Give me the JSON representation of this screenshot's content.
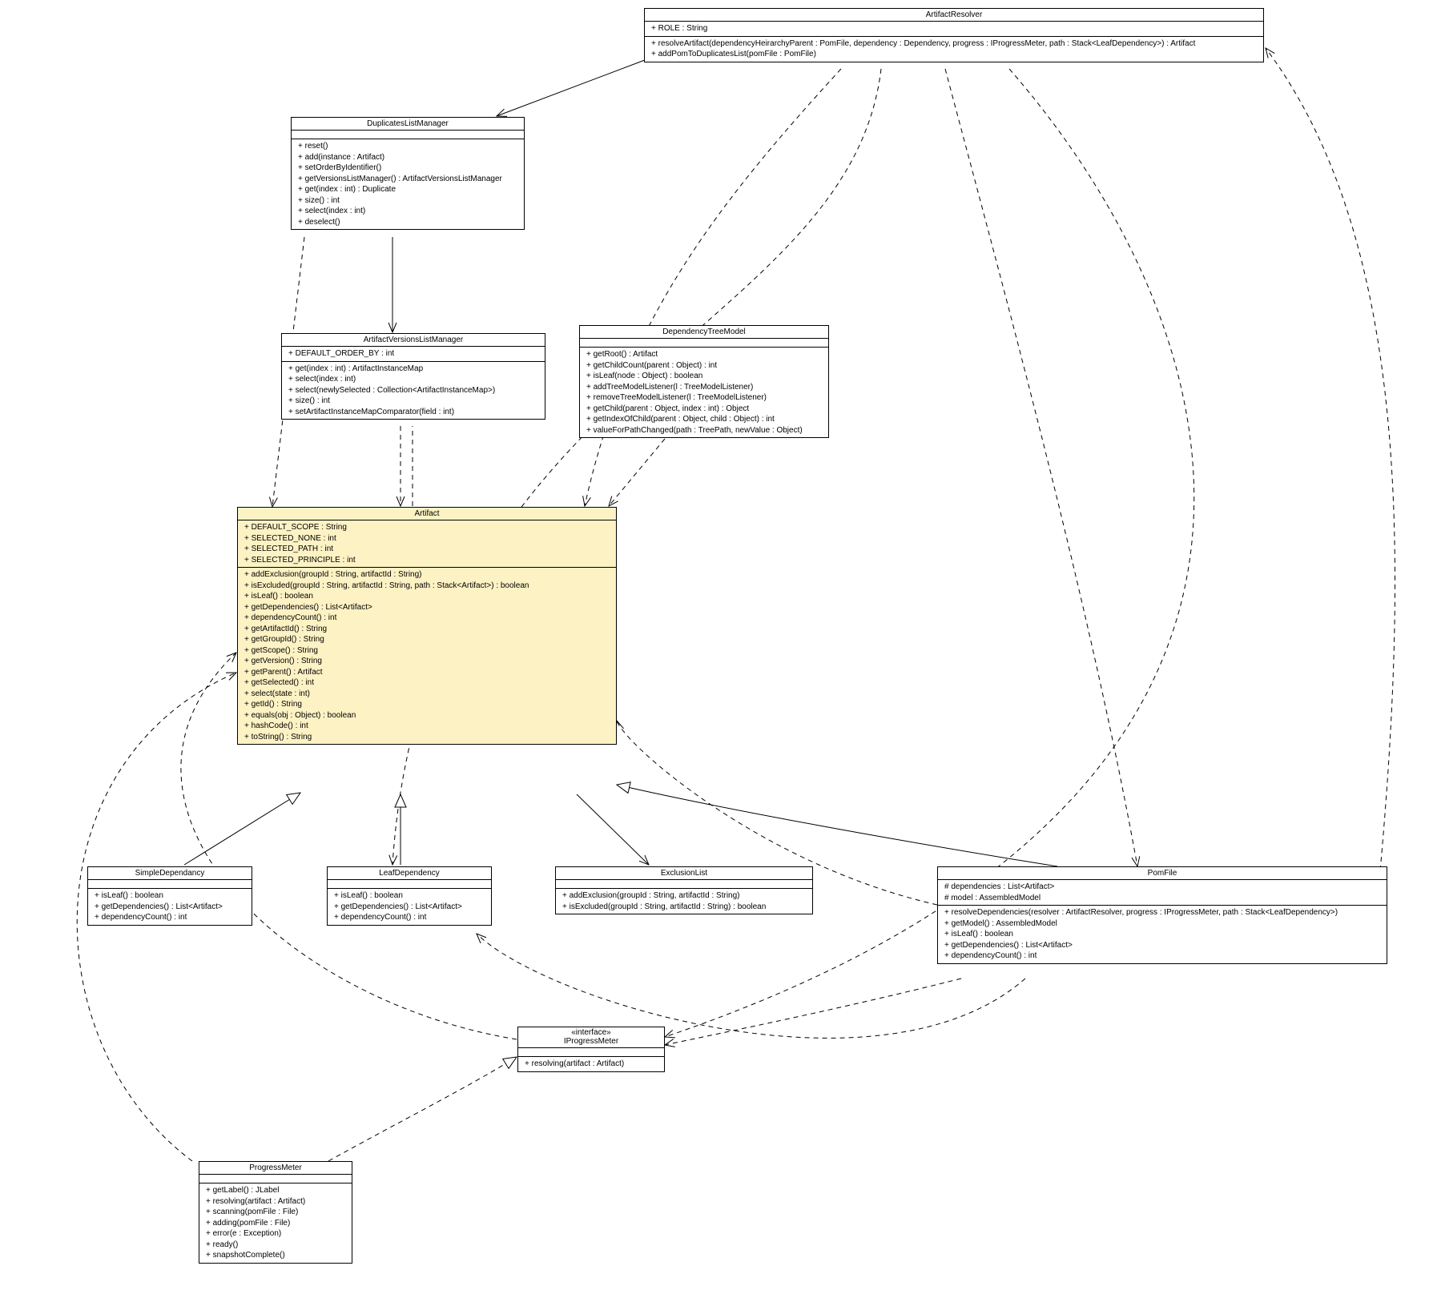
{
  "classes": {
    "artifactResolver": {
      "title": "ArtifactResolver",
      "attrs": [
        "+ ROLE : String"
      ],
      "ops": [
        "+ resolveArtifact(dependencyHeirarchyParent : PomFile, dependency : Dependency, progress : IProgressMeter, path : Stack<LeafDependency>) : Artifact",
        "+ addPomToDuplicatesList(pomFile : PomFile)"
      ]
    },
    "duplicatesListManager": {
      "title": "DuplicatesListManager",
      "attrs": [],
      "ops": [
        "+ reset()",
        "+ add(instance : Artifact)",
        "+ setOrderByIdentifier()",
        "+ getVersionsListManager() : ArtifactVersionsListManager",
        "+ get(index : int) : Duplicate",
        "+ size() : int",
        "+ select(index : int)",
        "+ deselect()"
      ]
    },
    "artifactVersionsListManager": {
      "title": "ArtifactVersionsListManager",
      "attrs": [
        "+ DEFAULT_ORDER_BY : int"
      ],
      "ops": [
        "+ get(index : int) : ArtifactInstanceMap",
        "+ select(index : int)",
        "+ select(newlySelected : Collection<ArtifactInstanceMap>)",
        "+ size() : int",
        "+ setArtifactInstanceMapComparator(field : int)"
      ]
    },
    "dependencyTreeModel": {
      "title": "DependencyTreeModel",
      "attrs": [],
      "ops": [
        "+ getRoot() : Artifact",
        "+ getChildCount(parent : Object) : int",
        "+ isLeaf(node : Object) : boolean",
        "+ addTreeModelListener(l : TreeModelListener)",
        "+ removeTreeModelListener(l : TreeModelListener)",
        "+ getChild(parent : Object, index : int) : Object",
        "+ getIndexOfChild(parent : Object, child : Object) : int",
        "+ valueForPathChanged(path : TreePath, newValue : Object)"
      ]
    },
    "artifact": {
      "title": "Artifact",
      "attrs": [
        "+ DEFAULT_SCOPE : String",
        "+ SELECTED_NONE : int",
        "+ SELECTED_PATH : int",
        "+ SELECTED_PRINCIPLE : int"
      ],
      "ops": [
        "+ addExclusion(groupId : String, artifactId : String)",
        "+ isExcluded(groupId : String, artifactId : String, path : Stack<Artifact>) : boolean",
        "+ isLeaf() : boolean",
        "+ getDependencies() : List<Artifact>",
        "+ dependencyCount() : int",
        "+ getArtifactId() : String",
        "+ getGroupId() : String",
        "+ getScope() : String",
        "+ getVersion() : String",
        "+ getParent() : Artifact",
        "+ getSelected() : int",
        "+ select(state : int)",
        "+ getId() : String",
        "+ equals(obj : Object) : boolean",
        "+ hashCode() : int",
        "+ toString() : String"
      ]
    },
    "simpleDependancy": {
      "title": "SimpleDependancy",
      "attrs": [],
      "ops": [
        "+ isLeaf() : boolean",
        "+ getDependencies() : List<Artifact>",
        "+ dependencyCount() : int"
      ]
    },
    "leafDependency": {
      "title": "LeafDependency",
      "attrs": [],
      "ops": [
        "+ isLeaf() : boolean",
        "+ getDependencies() : List<Artifact>",
        "+ dependencyCount() : int"
      ]
    },
    "exclusionList": {
      "title": "ExclusionList",
      "attrs": [],
      "ops": [
        "+ addExclusion(groupId : String, artifactId : String)",
        "+ isExcluded(groupId : String, artifactId : String) : boolean"
      ]
    },
    "pomFile": {
      "title": "PomFile",
      "attrs": [
        "# dependencies : List<Artifact>",
        "# model : AssembledModel"
      ],
      "ops": [
        "+ resolveDependencies(resolver : ArtifactResolver, progress : IProgressMeter, path : Stack<LeafDependency>)",
        "+ getModel() : AssembledModel",
        "+ isLeaf() : boolean",
        "+ getDependencies() : List<Artifact>",
        "+ dependencyCount() : int"
      ]
    },
    "iProgressMeter": {
      "stereotype": "«interface»",
      "title": "IProgressMeter",
      "attrs": [],
      "ops": [
        "+ resolving(artifact : Artifact)"
      ]
    },
    "progressMeter": {
      "title": "ProgressMeter",
      "attrs": [],
      "ops": [
        "+ getLabel() : JLabel",
        "+ resolving(artifact : Artifact)",
        "+ scanning(pomFile : File)",
        "+ adding(pomFile : File)",
        "+ error(e : Exception)",
        "+ ready()",
        "+ snapshotComplete()"
      ]
    }
  }
}
